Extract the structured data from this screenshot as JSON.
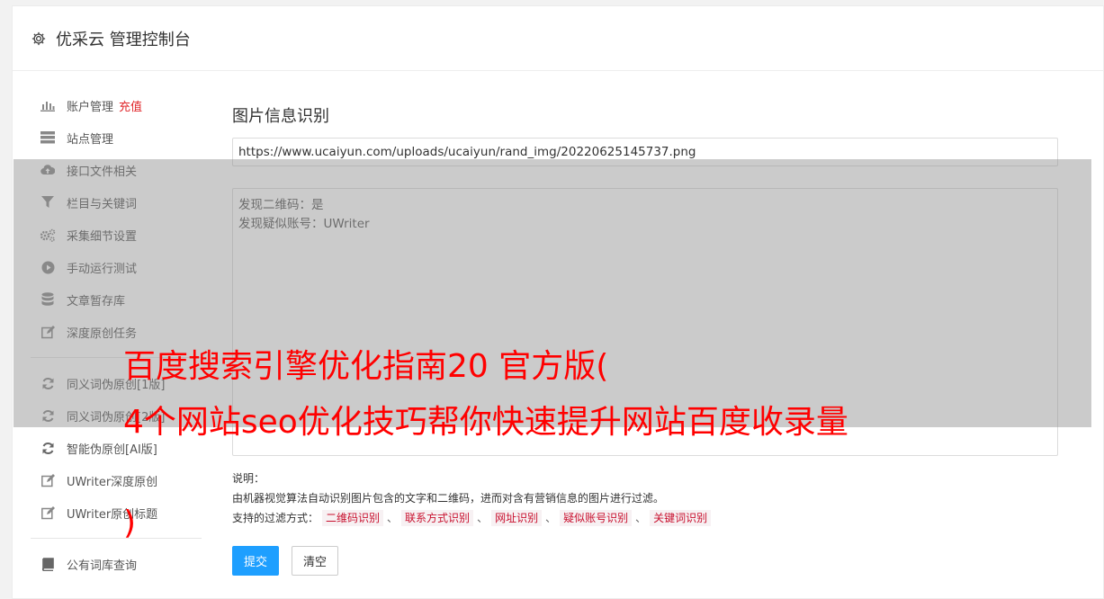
{
  "header": {
    "title": "优采云 管理控制台",
    "icon": "gear-icon"
  },
  "sidebar": {
    "items": [
      {
        "label": "账户管理",
        "accent": "充值",
        "icon": "bar-chart-icon"
      },
      {
        "label": "站点管理",
        "icon": "server-icon"
      },
      {
        "label": "接口文件相关",
        "icon": "cloud-upload-icon"
      },
      {
        "label": "栏目与关键词",
        "icon": "filter-icon"
      },
      {
        "label": "采集细节设置",
        "icon": "gears-icon"
      },
      {
        "label": "手动运行测试",
        "icon": "play-icon"
      },
      {
        "label": "文章暂存库",
        "icon": "database-icon"
      },
      {
        "label": "深度原创任务",
        "icon": "edit-icon"
      },
      {
        "label": "同义词伪原创[1版]",
        "icon": "refresh-icon"
      },
      {
        "label": "同义词伪原创[2版]",
        "icon": "refresh-icon"
      },
      {
        "label": "智能伪原创[AI版]",
        "icon": "refresh-icon"
      },
      {
        "label": "UWriter深度原创",
        "icon": "edit-icon"
      },
      {
        "label": "UWriter原创标题",
        "icon": "edit-icon"
      },
      {
        "label": "公有词库查询",
        "icon": "book-icon"
      }
    ]
  },
  "main": {
    "title": "图片信息识别",
    "url_value": "https://www.ucaiyun.com/uploads/ucaiyun/rand_img/20220625145737.png",
    "result_lines": [
      "发现二维码：是",
      "发现疑似账号：UWriter"
    ],
    "notes": {
      "heading": "说明：",
      "line1": "由机器视觉算法自动识别图片包含的文字和二维码，进而对含有营销信息的图片进行过滤。",
      "filter_prefix": "支持的过滤方式：",
      "filters": [
        "二维码识别",
        "联系方式识别",
        "网址识别",
        "疑似账号识别",
        "关键词识别"
      ],
      "separator": "、"
    },
    "submit_label": "提交",
    "clear_label": "清空"
  },
  "banner": {
    "line1": "百度搜索引擎优化指南20 官方版(",
    "line2": "4个网站seo优化技巧帮你快速提升网站百度收录量",
    "line3": ")"
  },
  "colors": {
    "accent_red": "#e0262a",
    "primary_blue": "#1e9fff",
    "banner_red": "#ff0000",
    "tag_red": "#c8102e"
  }
}
